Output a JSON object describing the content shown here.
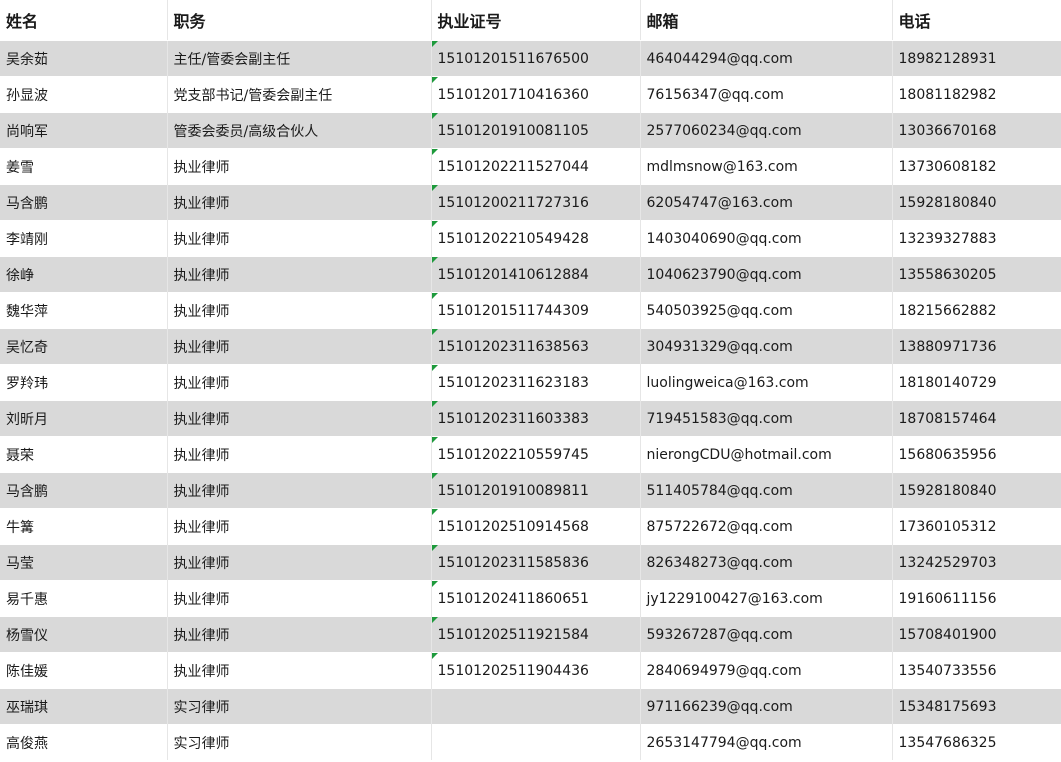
{
  "headers": [
    "姓名",
    "职务",
    "执业证号",
    "邮箱",
    "电话"
  ],
  "rows": [
    {
      "name": "吴余茹",
      "title": "主任/管委会副主任",
      "license": "15101201511676500",
      "email": "464044294@qq.com",
      "phone": "18982128931"
    },
    {
      "name": "孙显波",
      "title": "党支部书记/管委会副主任",
      "license": "15101201710416360",
      "email": "76156347@qq.com",
      "phone": "18081182982"
    },
    {
      "name": "尚响军",
      "title": "管委会委员/高级合伙人",
      "license": "15101201910081105",
      "email": "2577060234@qq.com",
      "phone": "13036670168"
    },
    {
      "name": "姜雪",
      "title": "执业律师",
      "license": "15101202211527044",
      "email": "mdlmsnow@163.com",
      "phone": "13730608182"
    },
    {
      "name": "马含鹏",
      "title": "执业律师",
      "license": "15101200211727316",
      "email": "62054747@163.com",
      "phone": "15928180840"
    },
    {
      "name": "李靖刚",
      "title": "执业律师",
      "license": "15101202210549428",
      "email": "1403040690@qq.com",
      "phone": "13239327883"
    },
    {
      "name": "徐峥",
      "title": "执业律师",
      "license": "15101201410612884",
      "email": "1040623790@qq.com",
      "phone": "13558630205"
    },
    {
      "name": "魏华萍",
      "title": "执业律师",
      "license": "15101201511744309",
      "email": "540503925@qq.com",
      "phone": "18215662882"
    },
    {
      "name": "吴忆奇",
      "title": "执业律师",
      "license": "15101202311638563",
      "email": "304931329@qq.com",
      "phone": "13880971736"
    },
    {
      "name": "罗羚玮",
      "title": "执业律师",
      "license": "15101202311623183",
      "email": "luolingweica@163.com",
      "phone": "18180140729"
    },
    {
      "name": "刘昕月",
      "title": "执业律师",
      "license": "15101202311603383",
      "email": "719451583@qq.com",
      "phone": "18708157464"
    },
    {
      "name": "聂荣",
      "title": "执业律师",
      "license": "15101202210559745",
      "email": "nierongCDU@hotmail.com",
      "phone": "15680635956"
    },
    {
      "name": "马含鹏",
      "title": "执业律师",
      "license": "15101201910089811",
      "email": "511405784@qq.com",
      "phone": "15928180840"
    },
    {
      "name": "牛篝",
      "title": "执业律师",
      "license": "15101202510914568",
      "email": "875722672@qq.com",
      "phone": "17360105312"
    },
    {
      "name": "马莹",
      "title": "执业律师",
      "license": "15101202311585836",
      "email": "826348273@qq.com",
      "phone": "13242529703"
    },
    {
      "name": "易千惠",
      "title": "执业律师",
      "license": "15101202411860651",
      "email": "jy1229100427@163.com",
      "phone": "19160611156"
    },
    {
      "name": "杨雪仪",
      "title": "执业律师",
      "license": "15101202511921584",
      "email": "593267287@qq.com",
      "phone": "15708401900"
    },
    {
      "name": "陈佳媛",
      "title": "执业律师",
      "license": "15101202511904436",
      "email": "2840694979@qq.com",
      "phone": "13540733556"
    },
    {
      "name": "巫瑞琪",
      "title": "实习律师",
      "license": "",
      "email": "971166239@qq.com",
      "phone": "15348175693"
    },
    {
      "name": "高俊燕",
      "title": "实习律师",
      "license": "",
      "email": "2653147794@qq.com",
      "phone": "13547686325"
    }
  ],
  "colors": {
    "shade": "#d9d9d9",
    "marker": "#1e9a3c"
  }
}
